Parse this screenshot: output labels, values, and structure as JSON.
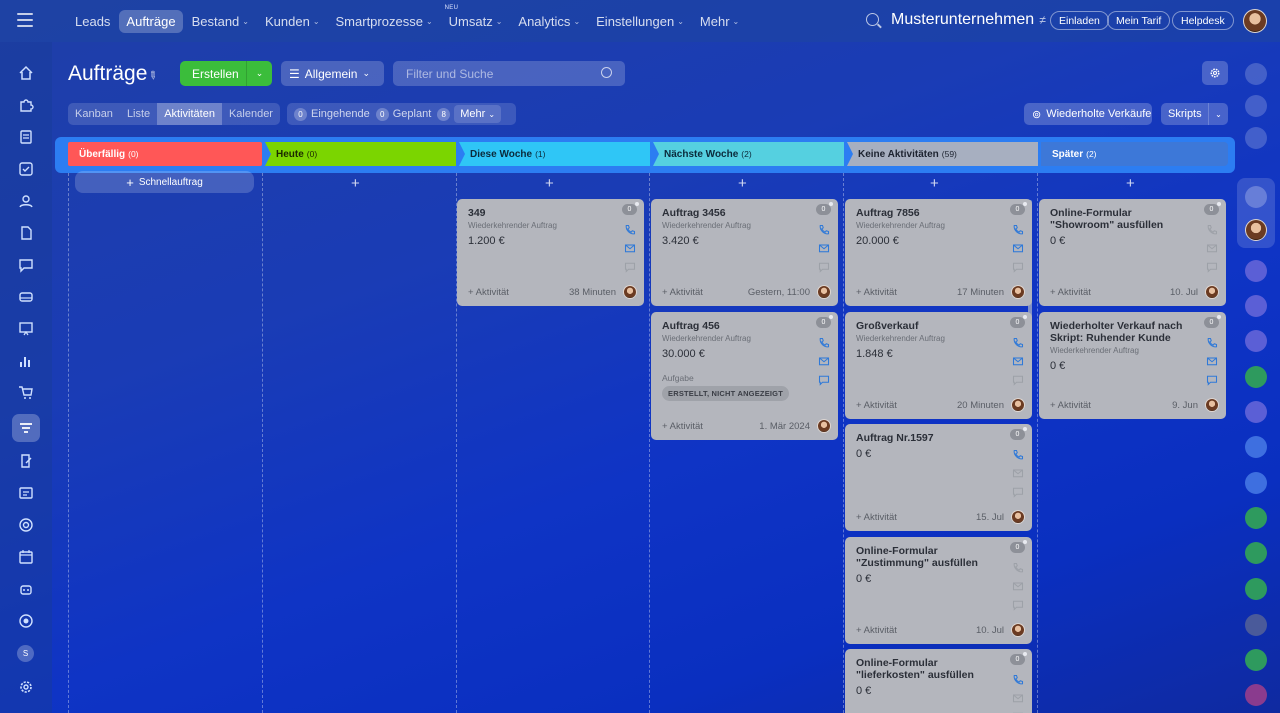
{
  "topnav": {
    "items": [
      {
        "label": "Leads",
        "chev": false
      },
      {
        "label": "Aufträge",
        "chev": false,
        "active": true
      },
      {
        "label": "Bestand",
        "chev": true
      },
      {
        "label": "Kunden",
        "chev": true
      },
      {
        "label": "Smartprozesse",
        "chev": true
      },
      {
        "label": "Umsatz",
        "chev": true,
        "badge": "NEU"
      },
      {
        "label": "Analytics",
        "chev": true
      },
      {
        "label": "Einstellungen",
        "chev": true
      },
      {
        "label": "Mehr",
        "chev": true
      }
    ],
    "company": "Musterunternehmen",
    "company_symbol": "≠",
    "buttons": {
      "invite": "Einladen",
      "tariff": "Mein Tarif",
      "helpdesk": "Helpdesk"
    }
  },
  "page": {
    "title": "Aufträge",
    "create": "Erstellen",
    "general": "Allgemein",
    "filter_placeholder": "Filter und Suche"
  },
  "views": {
    "kanban": "Kanban",
    "list": "Liste",
    "activities": "Aktivitäten",
    "calendar": "Kalender"
  },
  "counters": {
    "incoming_n": "0",
    "incoming": "Eingehende",
    "planned_n": "0",
    "planned": "Geplant",
    "more_n": "8",
    "more": "Mehr"
  },
  "toolbar": {
    "recurring": "Wiederholte Verkäufe",
    "scripts": "Skripts"
  },
  "sidebar": {
    "user_initial": "S"
  },
  "stages": [
    {
      "name": "Überfällig",
      "count": "(0)",
      "color": "#ff5757",
      "text": "#ffffff"
    },
    {
      "name": "Heute",
      "count": "(0)",
      "color": "#7bd500",
      "text": "#1c2a00"
    },
    {
      "name": "Diese Woche",
      "count": "(1)",
      "color": "#2fc6f6",
      "text": "#0b2a3b"
    },
    {
      "name": "Nächste Woche",
      "count": "(2)",
      "color": "#55d0e0",
      "text": "#0b2a3b"
    },
    {
      "name": "Keine Aktivitäten",
      "count": "(59)",
      "color": "#a7afc0",
      "text": "#1d2330"
    },
    {
      "name": "Später",
      "count": "(2)",
      "color": "#3d78d8",
      "text": "#ffffff"
    }
  ],
  "quick_deal": "Schnellauftrag",
  "cards": {
    "c1": {
      "title": "349",
      "sub": "Wiederkehrender Auftrag",
      "price": "1.200 €",
      "count": "0",
      "add": "+ Aktivität",
      "time": "38 Minuten"
    },
    "c2": {
      "title": "Auftrag 3456",
      "sub": "Wiederkehrender Auftrag",
      "price": "3.420 €",
      "count": "0",
      "add": "+ Aktivität",
      "time": "Gestern, 11:00"
    },
    "c3": {
      "title": "Auftrag 456",
      "sub": "Wiederkehrender Auftrag",
      "price": "30.000 €",
      "count": "0",
      "label": "Aufgabe",
      "tag": "ERSTELLT, NICHT ANGEZEIGT",
      "add": "+ Aktivität",
      "time": "1. Mär 2024"
    },
    "c4": {
      "title": "Auftrag 7856",
      "sub": "Wiederkehrender Auftrag",
      "price": "20.000 €",
      "count": "0",
      "add": "+ Aktivität",
      "time": "17 Minuten"
    },
    "c5": {
      "title": "Großverkauf",
      "sub": "Wiederkehrender Auftrag",
      "price": "1.848 €",
      "count": "0",
      "add": "+ Aktivität",
      "time": "20 Minuten"
    },
    "c6": {
      "title": "Auftrag Nr.1597",
      "price": "0 €",
      "count": "0",
      "add": "+ Aktivität",
      "time": "15. Jul"
    },
    "c7": {
      "title": "Online-Formular \"Zustimmung\" ausfüllen",
      "price": "0 €",
      "count": "0",
      "add": "+ Aktivität",
      "time": "10. Jul"
    },
    "c8": {
      "title": "Online-Formular \"lieferkosten\" ausfüllen",
      "price": "0 €",
      "count": "0"
    },
    "c9": {
      "title": "Online-Formular \"Showroom\" ausfüllen",
      "price": "0 €",
      "count": "0",
      "add": "+ Aktivität",
      "time": "10. Jul"
    },
    "c10": {
      "title": "Wiederholter Verkauf nach Skript: Ruhender Kunde",
      "sub": "Wiederkehrender Auftrag",
      "price": "0 €",
      "count": "0",
      "add": "+ Aktivität",
      "time": "9. Jun"
    }
  }
}
